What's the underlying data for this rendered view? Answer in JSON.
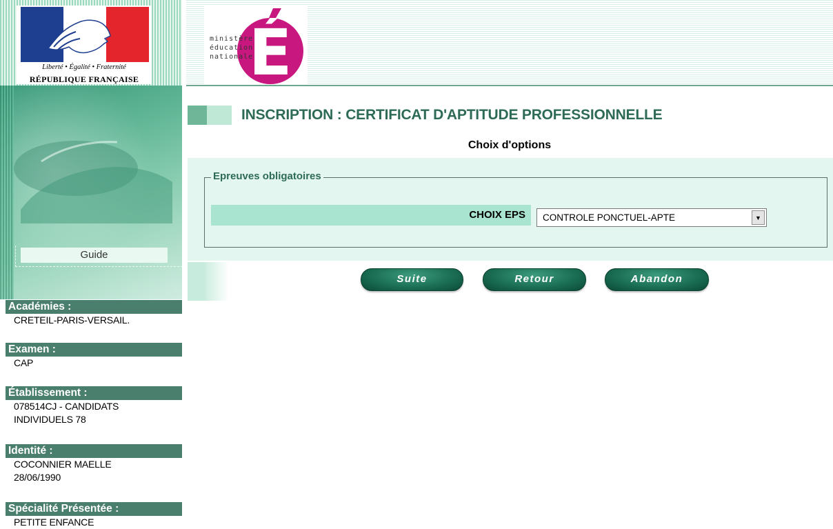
{
  "logos": {
    "republique_motto": "Liberté • Égalité • Fraternité",
    "republique_name": "RÉPUBLIQUE FRANÇAISE",
    "ministere_lines": [
      "ministère",
      "éducation",
      "nationale"
    ],
    "ministere_letter": "É"
  },
  "sidebar": {
    "guide_label": "Guide",
    "info": [
      {
        "label": "Académies :",
        "lines": [
          "CRETEIL-PARIS-VERSAIL."
        ]
      },
      {
        "label": "Examen :",
        "lines": [
          "CAP"
        ]
      },
      {
        "label": "Établissement :",
        "lines": [
          "078514CJ - CANDIDATS",
          "INDIVIDUELS 78"
        ]
      },
      {
        "label": "Identité :",
        "lines": [
          "COCONNIER MAELLE",
          "28/06/1990"
        ]
      },
      {
        "label": "Spécialité Présentée :",
        "lines": [
          "PETITE ENFANCE"
        ]
      }
    ]
  },
  "main": {
    "title": "INSCRIPTION : CERTIFICAT D'APTITUDE PROFESSIONNELLE",
    "subtitle": "Choix d'options",
    "fieldset_legend": "Epreuves obligatoires",
    "eps_label": "CHOIX EPS",
    "eps_selected": "CONTROLE PONCTUEL-APTE"
  },
  "buttons": {
    "suite": "Suite",
    "retour": "Retour",
    "abandon": "Abandon"
  },
  "colors": {
    "accent_green": "#2e6b56",
    "sidebar_header": "#4a7e6d",
    "form_background": "#e3f7f0",
    "flag_blue": "#1e3f8f",
    "flag_red": "#e4252b",
    "ministere_magenta": "#c8177f"
  }
}
